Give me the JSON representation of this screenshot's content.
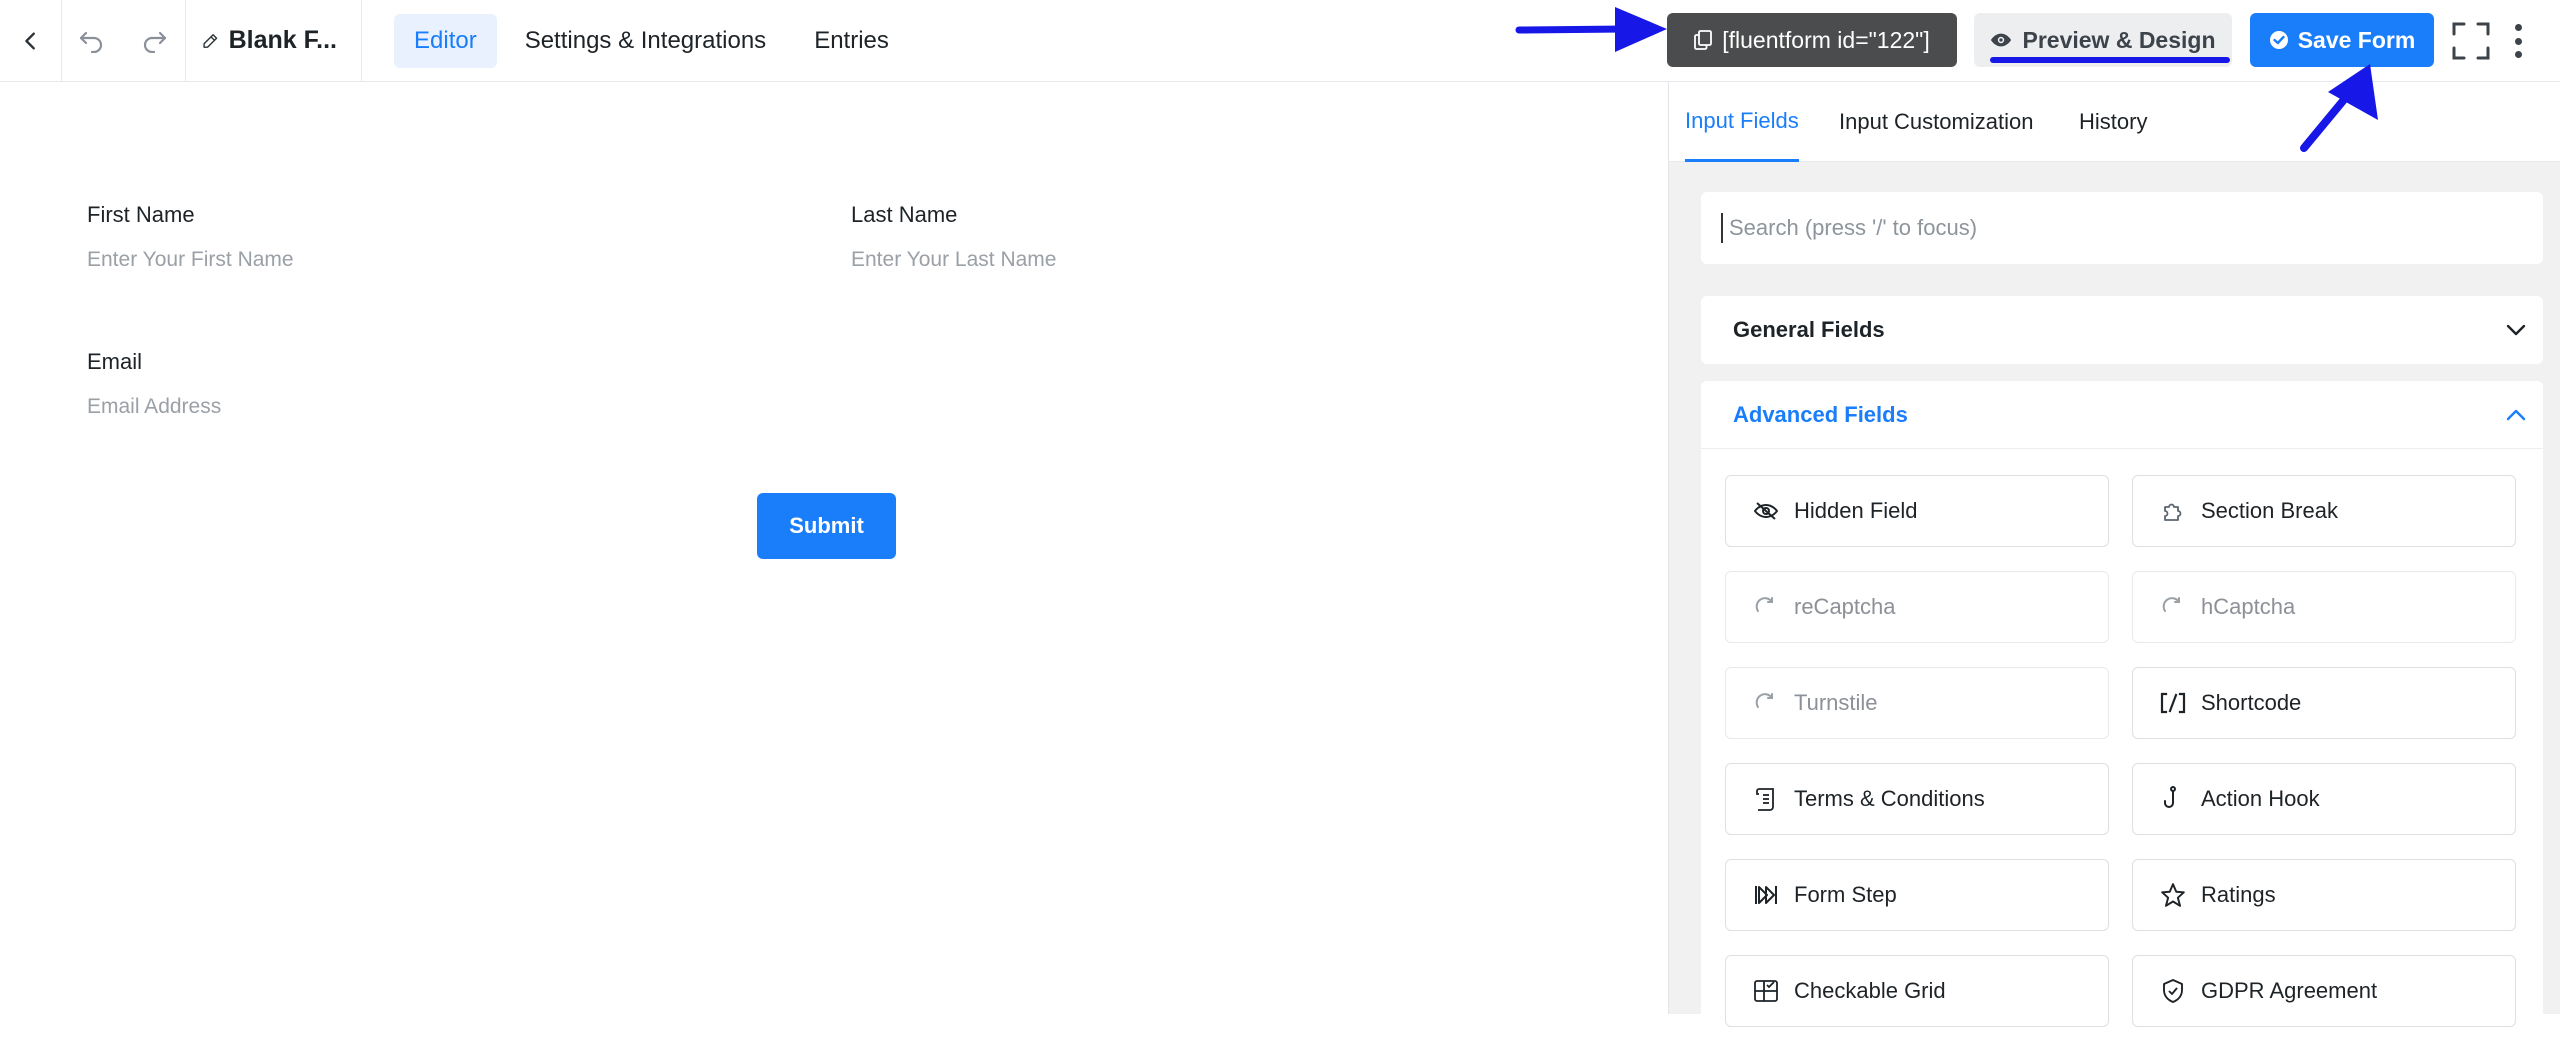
{
  "header": {
    "form_title": "Blank F...",
    "tabs": [
      {
        "label": "Editor",
        "active": true
      },
      {
        "label": "Settings & Integrations",
        "active": false
      },
      {
        "label": "Entries",
        "active": false
      }
    ],
    "shortcode_label": "[fluentform id=\"122\"]",
    "preview_label": "Preview & Design",
    "save_label": "Save Form"
  },
  "form": {
    "first_name": {
      "label": "First Name",
      "placeholder": "Enter Your First Name"
    },
    "last_name": {
      "label": "Last Name",
      "placeholder": "Enter Your Last Name"
    },
    "email": {
      "label": "Email",
      "placeholder": "Email Address"
    },
    "submit_label": "Submit"
  },
  "panel": {
    "tabs": [
      {
        "label": "Input Fields",
        "active": true
      },
      {
        "label": "Input Customization",
        "active": false
      },
      {
        "label": "History",
        "active": false
      }
    ],
    "search_placeholder": "Search (press '/' to focus)",
    "general_fields_label": "General Fields",
    "advanced_fields_label": "Advanced Fields",
    "advanced_fields": [
      {
        "label": "Hidden Field",
        "icon": "eye-slash-icon",
        "disabled": false
      },
      {
        "label": "Section Break",
        "icon": "puzzle-icon",
        "disabled": false
      },
      {
        "label": "reCaptcha",
        "icon": "captcha-icon",
        "disabled": true
      },
      {
        "label": "hCaptcha",
        "icon": "captcha-icon",
        "disabled": true
      },
      {
        "label": "Turnstile",
        "icon": "captcha-icon",
        "disabled": true
      },
      {
        "label": "Shortcode",
        "icon": "shortcode-icon",
        "disabled": false
      },
      {
        "label": "Terms & Conditions",
        "icon": "scroll-icon",
        "disabled": false
      },
      {
        "label": "Action Hook",
        "icon": "hook-icon",
        "disabled": false
      },
      {
        "label": "Form Step",
        "icon": "step-forward-icon",
        "disabled": false
      },
      {
        "label": "Ratings",
        "icon": "star-icon",
        "disabled": false
      },
      {
        "label": "Checkable Grid",
        "icon": "grid-check-icon",
        "disabled": false
      },
      {
        "label": "GDPR Agreement",
        "icon": "shield-icon",
        "disabled": false
      }
    ]
  },
  "colors": {
    "accent": "#1a7efb",
    "annotation": "#1717e8",
    "shortcode_bg": "#4b4c4d"
  }
}
